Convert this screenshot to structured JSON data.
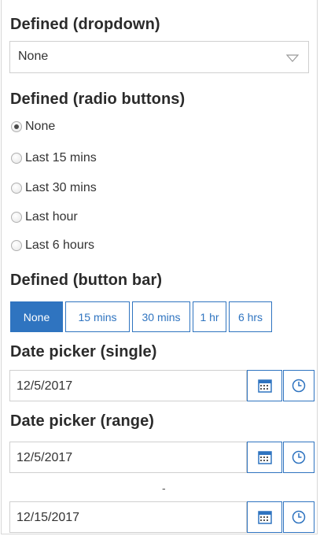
{
  "dropdown_section": {
    "title": "Defined (dropdown)",
    "selected": "None"
  },
  "radio_section": {
    "title": "Defined (radio buttons)",
    "options": [
      "None",
      "Last 15 mins",
      "Last 30 mins",
      "Last hour",
      "Last 6 hours"
    ],
    "selected": "None"
  },
  "buttonbar_section": {
    "title": "Defined (button bar)",
    "buttons": [
      "None",
      "15 mins",
      "30 mins",
      "1 hr",
      "6 hrs"
    ],
    "active": "None"
  },
  "date_single": {
    "title": "Date picker (single)",
    "value": "12/5/2017"
  },
  "date_range": {
    "title": "Date picker (range)",
    "start": "12/5/2017",
    "separator": "-",
    "end": "12/15/2017"
  },
  "colors": {
    "accent": "#2f74c0",
    "border": "#cfcfcf",
    "text": "#333333"
  }
}
